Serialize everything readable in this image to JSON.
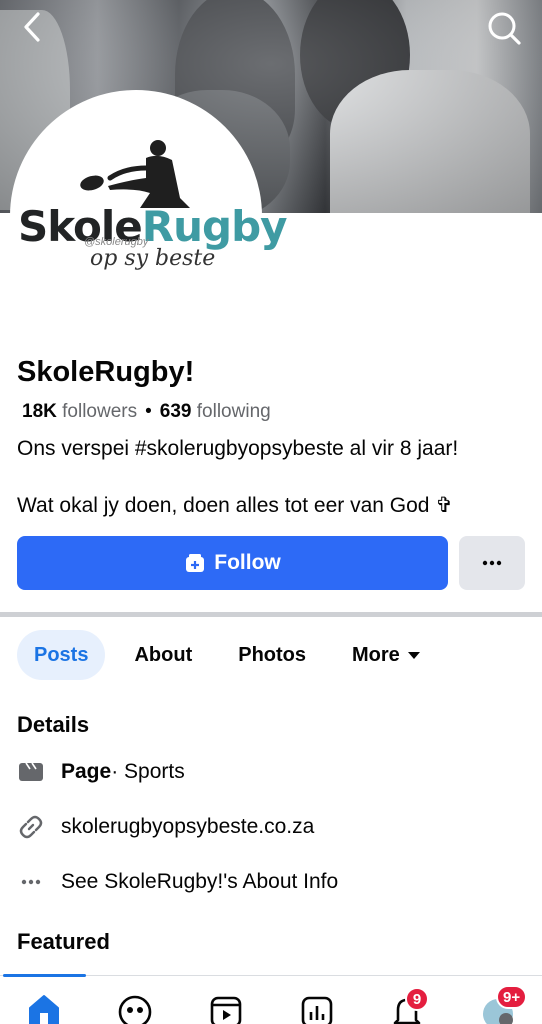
{
  "header": {
    "back_icon": "chevron-left-icon",
    "search_icon": "search-icon"
  },
  "avatar_logo": {
    "brand_part1": "Skole",
    "brand_part2": "Rugby",
    "handle": "@skolerugby",
    "tagline": "op sy beste"
  },
  "profile": {
    "name": "SkoleRugby!",
    "followers_count": "18K",
    "followers_label": "followers",
    "following_count": "639",
    "following_label": "following",
    "bio_line1": "Ons verspei #skolerugbyopsybeste al vir 8 jaar!",
    "bio_line2": "Wat okal jy doen, doen alles tot eer van God ✞"
  },
  "actions": {
    "follow_label": "Follow",
    "more_label": "···"
  },
  "tabs": [
    {
      "label": "Posts",
      "active": true
    },
    {
      "label": "About"
    },
    {
      "label": "Photos"
    },
    {
      "label": "More"
    }
  ],
  "details": {
    "title": "Details",
    "category_bold": "Page",
    "category_rest": " · Sports",
    "website": "skolerugbyopsybeste.co.za",
    "about_link": "See SkoleRugby!'s About Info"
  },
  "featured": {
    "title": "Featured"
  },
  "bottom_nav": {
    "notifications_badge": "9",
    "menu_badge": "9+"
  },
  "colors": {
    "accent": "#2d6af6",
    "tab_active_bg": "#e7f0fd",
    "tab_active_text": "#1b74e4",
    "badge": "#e41e3f",
    "logo_teal": "#3f9ba3"
  }
}
